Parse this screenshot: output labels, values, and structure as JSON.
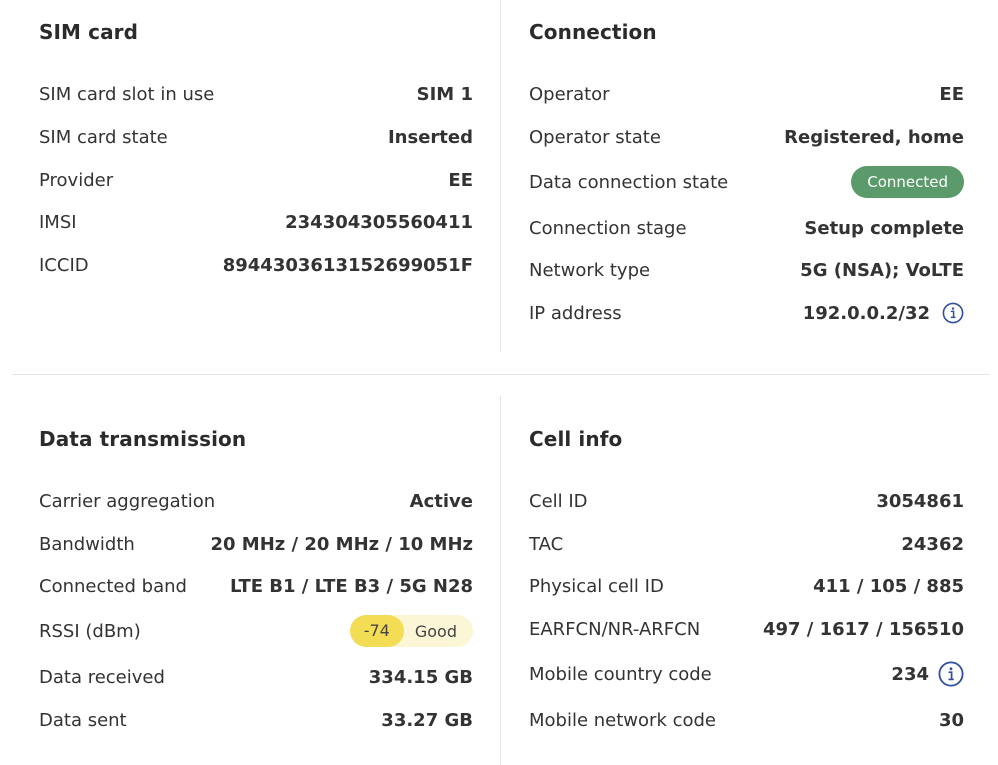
{
  "sim_card": {
    "title": "SIM card",
    "rows": [
      {
        "label": "SIM card slot in use",
        "value": "SIM 1"
      },
      {
        "label": "SIM card state",
        "value": "Inserted"
      },
      {
        "label": "Provider",
        "value": "EE"
      },
      {
        "label": "IMSI",
        "value": "234304305560411"
      },
      {
        "label": "ICCID",
        "value": "8944303613152699051F"
      }
    ]
  },
  "connection": {
    "title": "Connection",
    "rows": [
      {
        "label": "Operator",
        "value": "EE"
      },
      {
        "label": "Operator state",
        "value": "Registered, home"
      },
      {
        "label": "Data connection state",
        "value": "Connected"
      },
      {
        "label": "Connection stage",
        "value": "Setup complete"
      },
      {
        "label": "Network type",
        "value": "5G (NSA); VoLTE"
      },
      {
        "label": "IP address",
        "value": "192.0.0.2/32"
      }
    ]
  },
  "data_transmission": {
    "title": "Data transmission",
    "rows": [
      {
        "label": "Carrier aggregation",
        "value": "Active"
      },
      {
        "label": "Bandwidth",
        "value": "20 MHz / 20 MHz / 10 MHz"
      },
      {
        "label": "Connected band",
        "value": "LTE B1 / LTE B3 / 5G N28"
      },
      {
        "label": "RSSI (dBm)",
        "value": "-74",
        "quality": "Good"
      },
      {
        "label": "Data received",
        "value": "334.15 GB"
      },
      {
        "label": "Data sent",
        "value": "33.27 GB"
      }
    ]
  },
  "cell_info": {
    "title": "Cell info",
    "rows": [
      {
        "label": "Cell ID",
        "value": "3054861"
      },
      {
        "label": "TAC",
        "value": "24362"
      },
      {
        "label": "Physical cell ID",
        "value": "411 / 105 / 885"
      },
      {
        "label": "EARFCN/NR-ARFCN",
        "value": "497 / 1617 / 156510"
      },
      {
        "label": "Mobile country code",
        "value": "234"
      },
      {
        "label": "Mobile network code",
        "value": "30"
      }
    ]
  },
  "icons": {
    "info": "info-circle-icon"
  },
  "colors": {
    "connected_badge": "#5a9a6b",
    "rssi_value": "#f3dd55",
    "rssi_track": "#fbf6d6",
    "info_icon": "#2f4f9e"
  }
}
